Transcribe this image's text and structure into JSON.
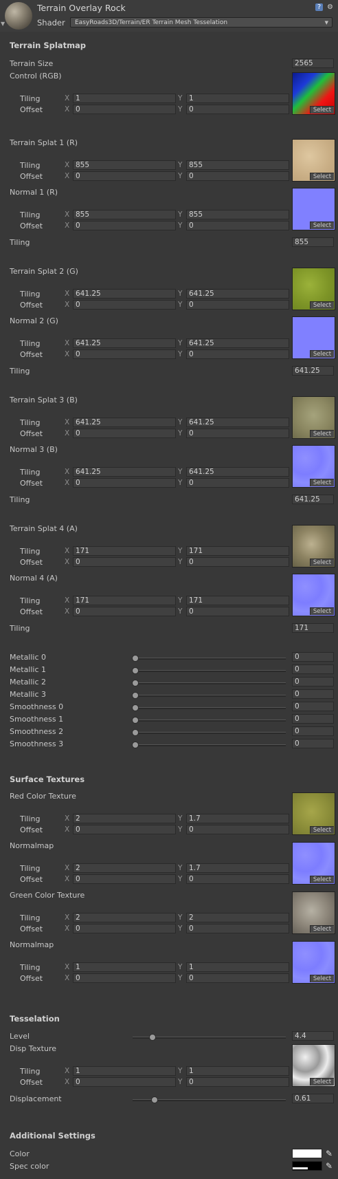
{
  "header": {
    "title": "Terrain Overlay Rock",
    "shader_label": "Shader",
    "shader_value": "EasyRoads3D/Terrain/ER Terrain Mesh Tesselation"
  },
  "common": {
    "tiling": "Tiling",
    "offset": "Offset",
    "x": "X",
    "y": "Y",
    "select": "Select"
  },
  "splatmap": {
    "heading": "Terrain Splatmap",
    "terrain_size_label": "Terrain Size",
    "terrain_size": "2565",
    "control": {
      "label": "Control (RGB)",
      "tiling_x": "1",
      "tiling_y": "1",
      "offset_x": "0",
      "offset_y": "0"
    },
    "splats": [
      {
        "label": "Terrain Splat 1 (R)",
        "tiling_x": "855",
        "tiling_y": "855",
        "offset_x": "0",
        "offset_y": "0",
        "normal_label": "Normal 1 (R)",
        "n_tiling_x": "855",
        "n_tiling_y": "855",
        "n_offset_x": "0",
        "n_offset_y": "0",
        "tiling_value": "855"
      },
      {
        "label": "Terrain Splat 2 (G)",
        "tiling_x": "641.25",
        "tiling_y": "641.25",
        "offset_x": "0",
        "offset_y": "0",
        "normal_label": "Normal 2 (G)",
        "n_tiling_x": "641.25",
        "n_tiling_y": "641.25",
        "n_offset_x": "0",
        "n_offset_y": "0",
        "tiling_value": "641.25"
      },
      {
        "label": "Terrain Splat 3 (B)",
        "tiling_x": "641.25",
        "tiling_y": "641.25",
        "offset_x": "0",
        "offset_y": "0",
        "normal_label": "Normal 3 (B)",
        "n_tiling_x": "641.25",
        "n_tiling_y": "641.25",
        "n_offset_x": "0",
        "n_offset_y": "0",
        "tiling_value": "641.25"
      },
      {
        "label": "Terrain Splat 4 (A)",
        "tiling_x": "171",
        "tiling_y": "171",
        "offset_x": "0",
        "offset_y": "0",
        "normal_label": "Normal 4 (A)",
        "n_tiling_x": "171",
        "n_tiling_y": "171",
        "n_offset_x": "0",
        "n_offset_y": "0",
        "tiling_value": "171"
      }
    ]
  },
  "sliders": [
    {
      "label": "Metallic 0",
      "value": "0"
    },
    {
      "label": "Metallic 1",
      "value": "0"
    },
    {
      "label": "Metallic 2",
      "value": "0"
    },
    {
      "label": "Metallic 3",
      "value": "0"
    },
    {
      "label": "Smoothness 0",
      "value": "0"
    },
    {
      "label": "Smoothness 1",
      "value": "0"
    },
    {
      "label": "Smoothness 2",
      "value": "0"
    },
    {
      "label": "Smoothness 3",
      "value": "0"
    }
  ],
  "surface": {
    "heading": "Surface Textures",
    "items": [
      {
        "label": "Red Color Texture",
        "tiling_x": "2",
        "tiling_y": "1.7",
        "offset_x": "0",
        "offset_y": "0"
      },
      {
        "label": "Normalmap",
        "tiling_x": "2",
        "tiling_y": "1.7",
        "offset_x": "0",
        "offset_y": "0"
      },
      {
        "label": "Green Color Texture",
        "tiling_x": "2",
        "tiling_y": "2",
        "offset_x": "0",
        "offset_y": "0"
      },
      {
        "label": "Normalmap",
        "tiling_x": "1",
        "tiling_y": "1",
        "offset_x": "0",
        "offset_y": "0"
      }
    ]
  },
  "tesselation": {
    "heading": "Tesselation",
    "level_label": "Level",
    "level_value": "4.4",
    "disp_label": "Disp Texture",
    "disp_tiling_x": "1",
    "disp_tiling_y": "1",
    "disp_offset_x": "0",
    "disp_offset_y": "0",
    "displacement_label": "Displacement",
    "displacement_value": "0.61"
  },
  "additional": {
    "heading": "Additional Settings",
    "color_label": "Color",
    "spec_label": "Spec color"
  },
  "colors": {
    "background": "#383838",
    "color_swatch": "#ffffff",
    "spec_swatch": "#000000"
  }
}
